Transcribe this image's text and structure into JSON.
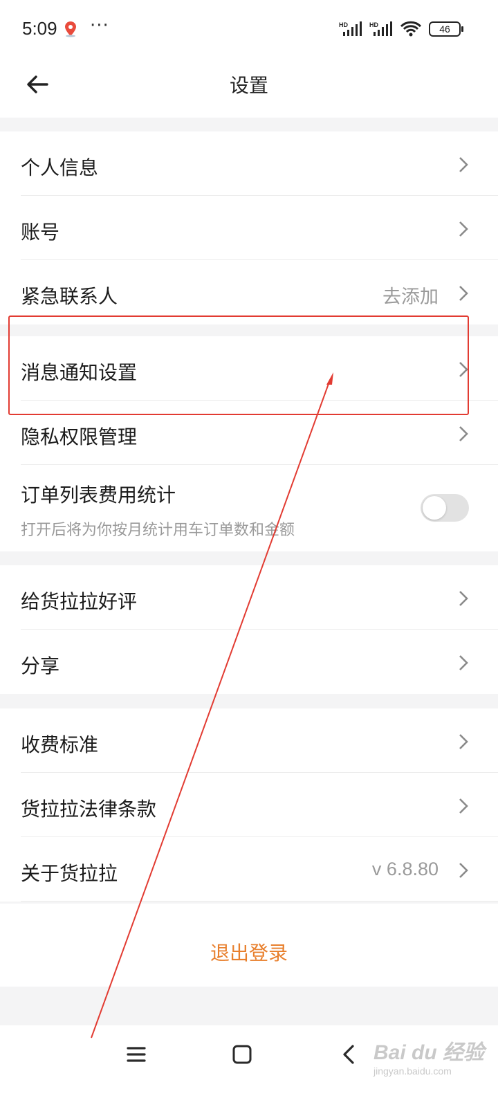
{
  "status_bar": {
    "time": "5:09",
    "dots": "···",
    "battery": "46"
  },
  "header": {
    "title": "设置"
  },
  "groups": [
    {
      "items": [
        {
          "label": "个人信息",
          "value": ""
        },
        {
          "label": "账号",
          "value": ""
        },
        {
          "label": "紧急联系人",
          "value": "去添加"
        }
      ]
    },
    {
      "items": [
        {
          "label": "消息通知设置",
          "value": ""
        },
        {
          "label": "隐私权限管理",
          "value": ""
        },
        {
          "label": "订单列表费用统计",
          "sublabel": "打开后将为你按月统计用车订单数和金额",
          "toggle_on": false
        }
      ]
    },
    {
      "items": [
        {
          "label": "给货拉拉好评",
          "value": ""
        },
        {
          "label": "分享",
          "value": ""
        }
      ]
    },
    {
      "items": [
        {
          "label": "收费标准",
          "value": ""
        },
        {
          "label": "货拉拉法律条款",
          "value": ""
        },
        {
          "label": "关于货拉拉",
          "value": "v 6.8.80"
        }
      ]
    }
  ],
  "logout": {
    "label": "退出登录"
  },
  "colors": {
    "accent": "#e87f2c",
    "annotation": "#e23b32",
    "separator": "#f4f4f5"
  },
  "watermark": {
    "logo": "Bai du 经验",
    "sub": "jingyan.baidu.com"
  }
}
